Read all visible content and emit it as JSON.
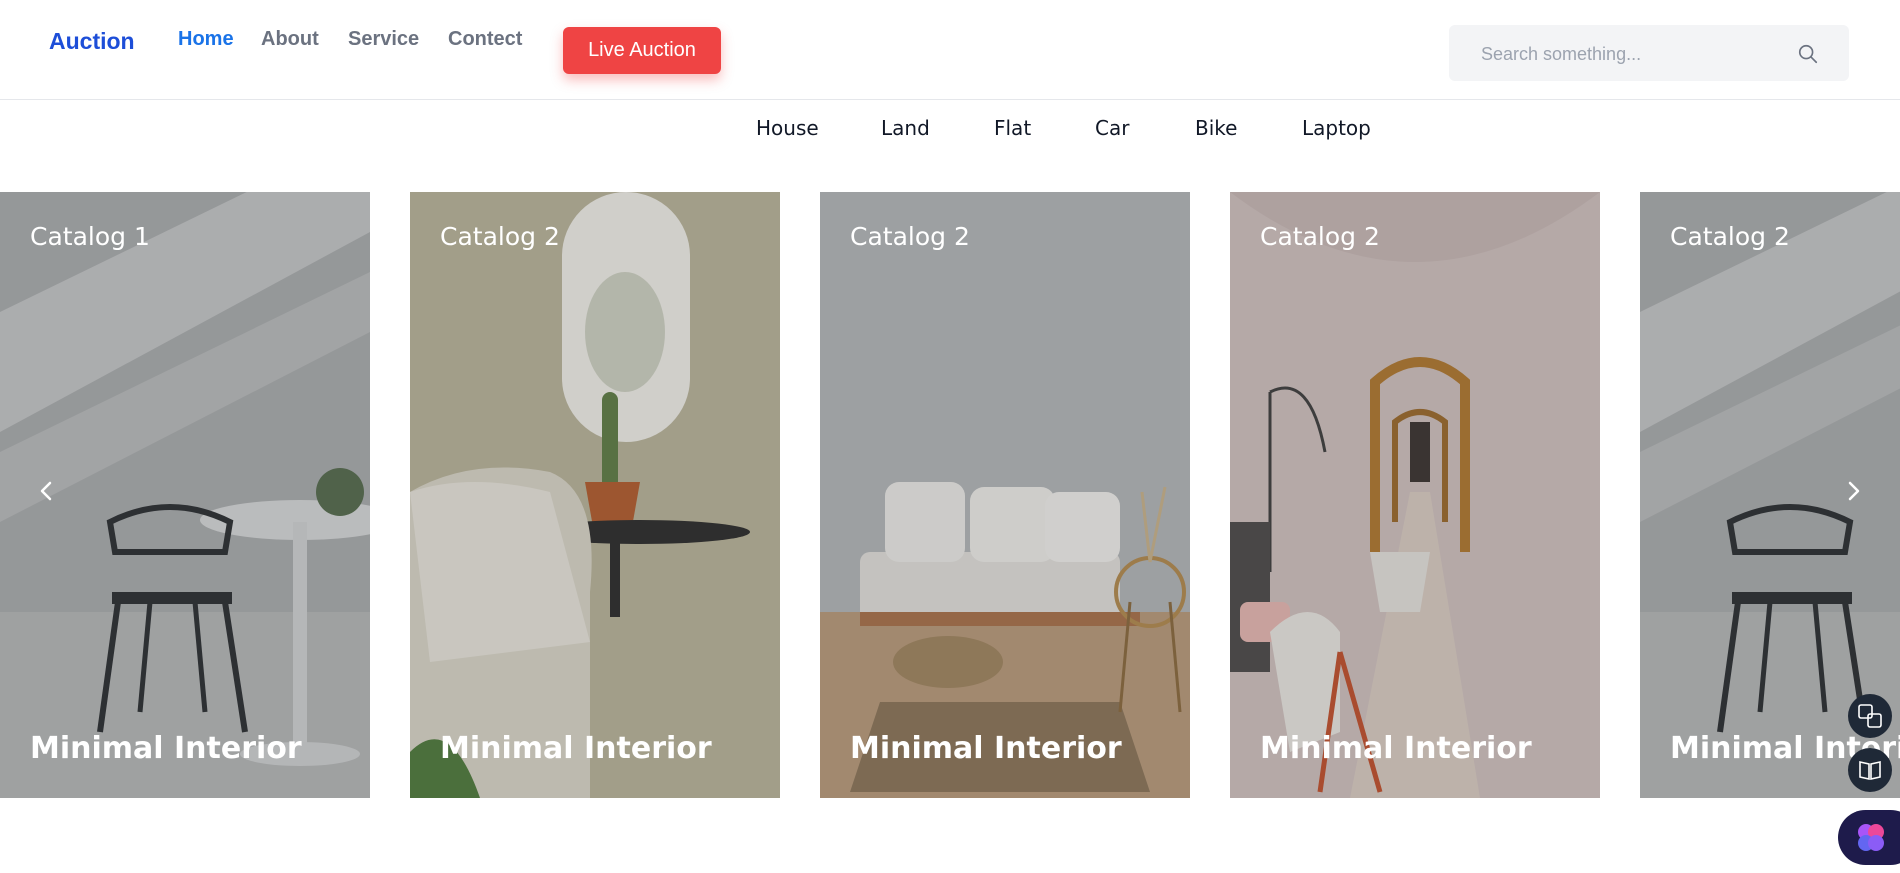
{
  "header": {
    "logo": "Auction",
    "nav": [
      {
        "label": "Home"
      },
      {
        "label": "About"
      },
      {
        "label": "Service"
      },
      {
        "label": "Contect"
      }
    ],
    "live_button": "Live Auction",
    "search_placeholder": "Search something..."
  },
  "categories": [
    "House",
    "Land",
    "Flat",
    "Car",
    "Bike",
    "Laptop"
  ],
  "cards": [
    {
      "catalog": "Catalog 1",
      "title": "Minimal Interior"
    },
    {
      "catalog": "Catalog 2",
      "title": "Minimal Interior"
    },
    {
      "catalog": "Catalog 2",
      "title": "Minimal Interior"
    },
    {
      "catalog": "Catalog 2",
      "title": "Minimal Interior"
    },
    {
      "catalog": "Catalog 2",
      "title": "Minimal Interior"
    }
  ],
  "colors": {
    "brand": "#1d4ed8",
    "nav_active": "#1a73e8",
    "live_button": "#ef4444"
  },
  "icons": {
    "search": "search-icon",
    "prev": "chevron-left-icon",
    "next": "chevron-right-icon",
    "translate": "translate-icon",
    "reader": "reader-icon",
    "ai": "brain-icon"
  }
}
